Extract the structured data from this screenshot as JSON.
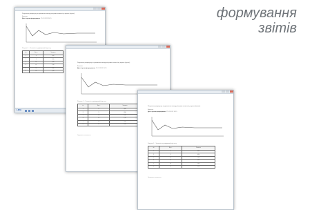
{
  "caption": {
    "line1": "формування",
    "line2": "звітів"
  },
  "report": {
    "title": "Результати розрахунку за допомогою методу кінцевих елементів у вузлах (оцінка).",
    "author_label": "Виконав:",
    "date_label": "Дата і время формування:",
    "date_value": "17.01.2013 13:15",
    "chart_caption": "Рисунок 1 – Залежність деформацій від часу",
    "table_caption": "Таблиця 1 – Деформації у вузлах",
    "footer_note": "Сформовано автоматично"
  },
  "table": {
    "headers": [
      "№",
      "Час, с",
      "Значення"
    ],
    "rows": [
      [
        "1",
        "0",
        "0,00"
      ],
      [
        "2",
        "5",
        "0,50"
      ],
      [
        "3",
        "10",
        "1,00"
      ],
      [
        "4",
        "15",
        "1,50"
      ],
      [
        "5",
        "20",
        "2,00"
      ],
      [
        "6",
        "25",
        "2,50"
      ]
    ]
  },
  "taskbar": {
    "logo": "LIRA"
  },
  "colors": {
    "window_border": "#b9c3cc",
    "titlebar": "#e8edf2",
    "close": "#d86a5a",
    "accent": "#2a5db0"
  }
}
